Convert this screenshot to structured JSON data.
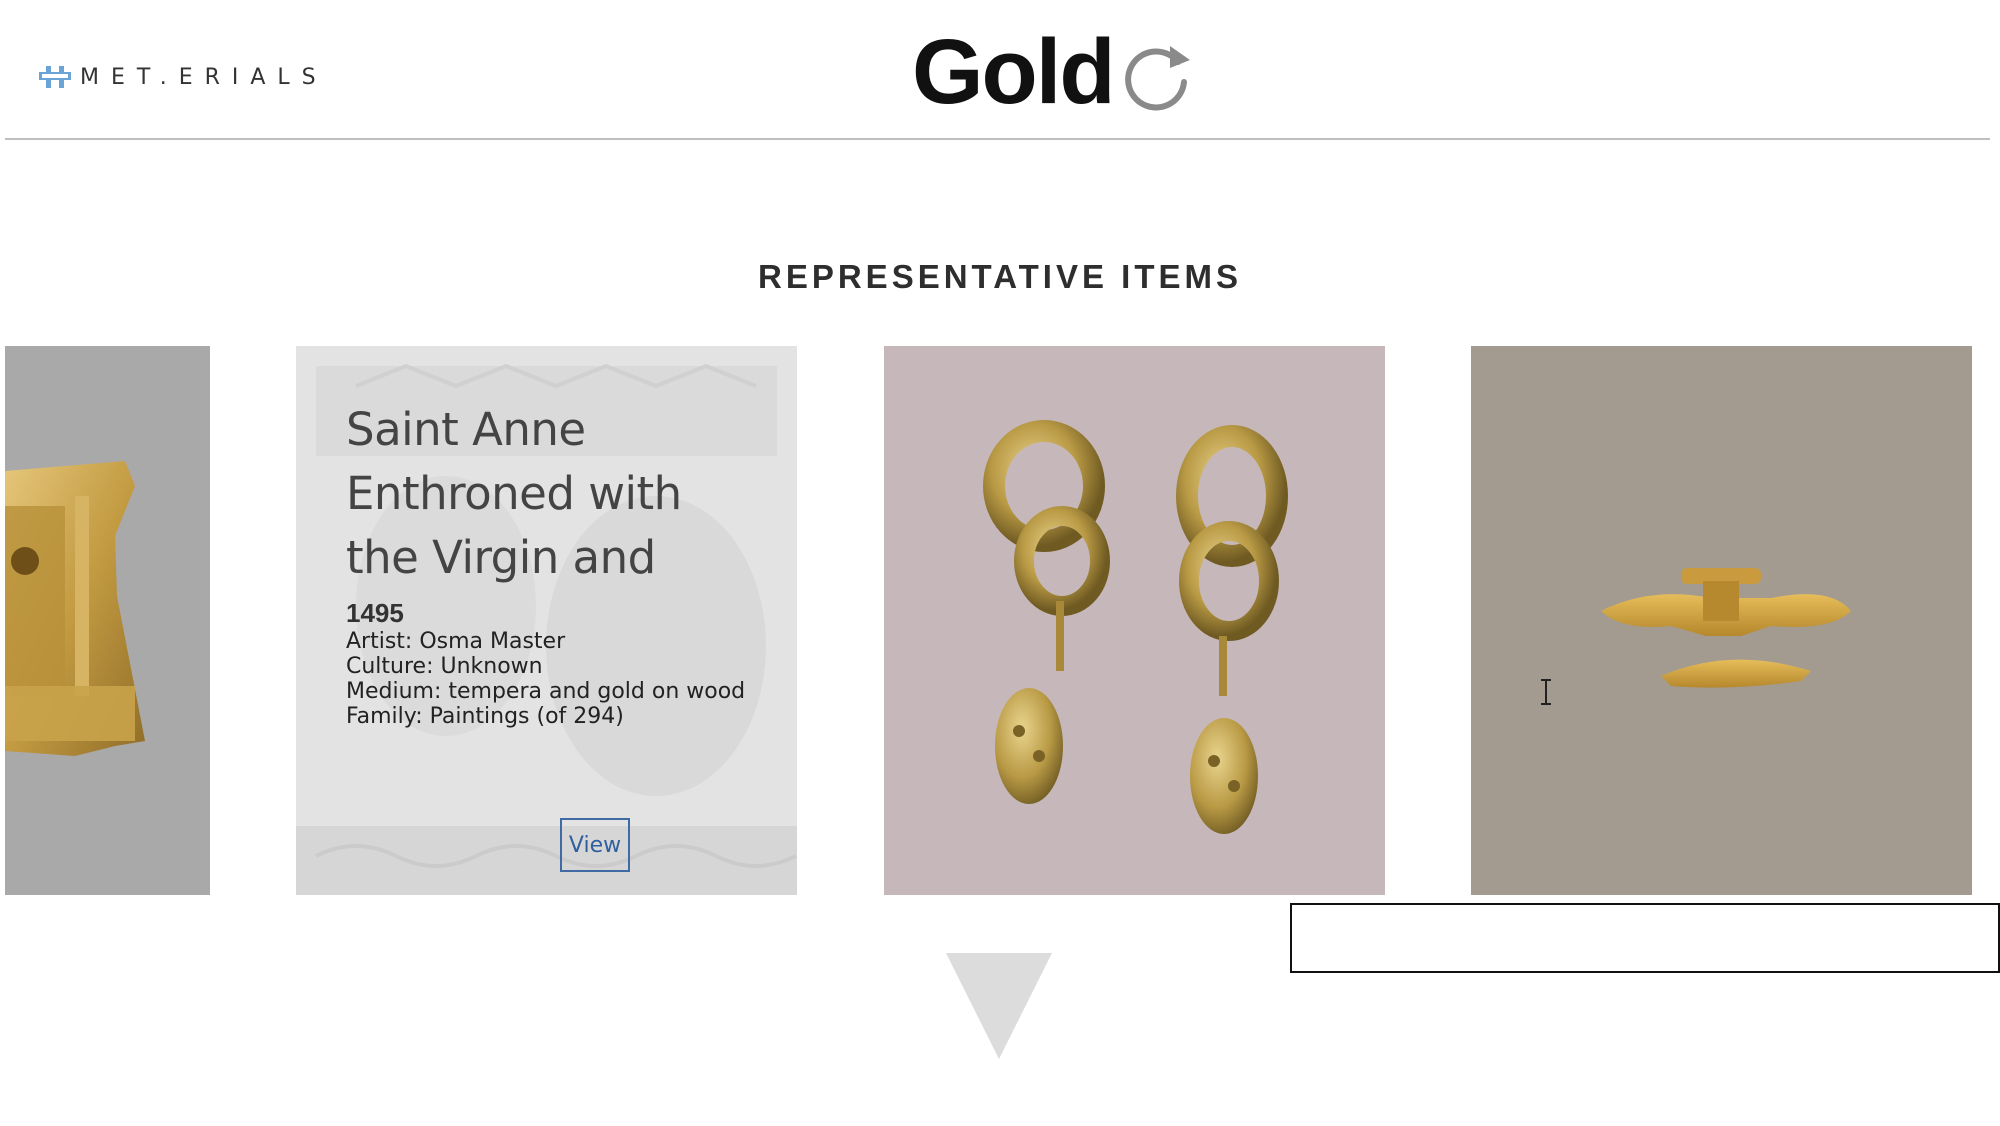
{
  "header": {
    "logo_text": "MET.ERIALS",
    "title": "Gold"
  },
  "section": {
    "title": "REPRESENTATIVE ITEMS"
  },
  "cards": [
    {
      "kind": "image",
      "subject": "gold pendant figure"
    },
    {
      "kind": "info",
      "title": "Saint Anne Enthroned with the Virgin and",
      "year": "1495",
      "artist": "Artist: Osma Master",
      "culture": "Culture: Unknown",
      "medium": "Medium: tempera and gold on wood",
      "family": "Family: Paintings (of 294)",
      "view_label": "View"
    },
    {
      "kind": "image",
      "subject": "gold earrings"
    },
    {
      "kind": "image",
      "subject": "gold winged ornament"
    }
  ],
  "colors": {
    "accent": "#3f6aa3",
    "gold": "#c9a34a"
  },
  "icons": {
    "logo": "metals-logo-icon",
    "refresh": "refresh-icon",
    "next": "down-arrow-icon"
  }
}
